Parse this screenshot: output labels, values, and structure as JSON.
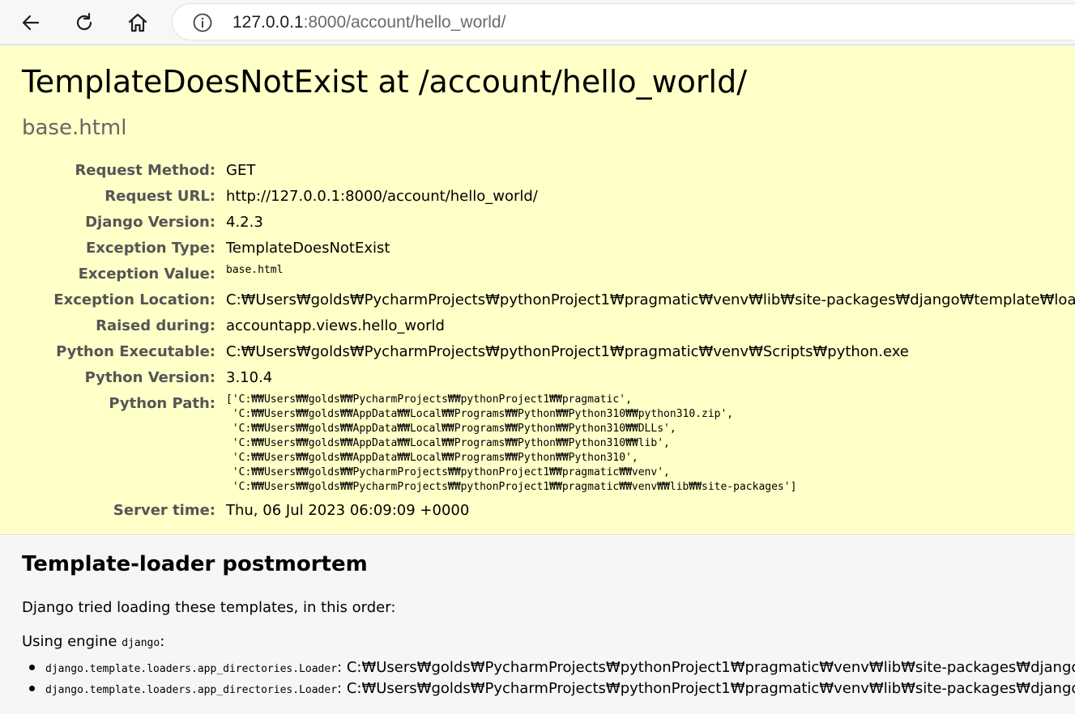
{
  "browser": {
    "url_host": "127.0.0.1",
    "url_rest": ":8000/account/hello_world/",
    "back_icon": "arrow-left-icon",
    "reload_icon": "reload-icon",
    "home_icon": "home-icon",
    "info_icon": "info-icon"
  },
  "summary": {
    "title": "TemplateDoesNotExist at /account/hello_world/",
    "subtitle": "base.html",
    "rows": [
      {
        "label": "Request Method:",
        "value": "GET"
      },
      {
        "label": "Request URL:",
        "value": "http://127.0.0.1:8000/account/hello_world/"
      },
      {
        "label": "Django Version:",
        "value": "4.2.3"
      },
      {
        "label": "Exception Type:",
        "value": "TemplateDoesNotExist"
      },
      {
        "label": "Exception Value:",
        "value": "base.html"
      },
      {
        "label": "Exception Location:",
        "value": "C:₩Users₩golds₩PycharmProjects₩pythonProject1₩pragmatic₩venv₩lib₩site-packages₩django₩template₩loader.py,"
      },
      {
        "label": "Raised during:",
        "value": "accountapp.views.hello_world"
      },
      {
        "label": "Python Executable:",
        "value": "C:₩Users₩golds₩PycharmProjects₩pythonProject1₩pragmatic₩venv₩Scripts₩python.exe"
      },
      {
        "label": "Python Version:",
        "value": "3.10.4"
      },
      {
        "label": "Python Path:",
        "value": ""
      },
      {
        "label": "Server time:",
        "value": "Thu, 06 Jul 2023 06:09:09 +0000"
      }
    ],
    "python_path": "['C:₩₩Users₩₩golds₩₩PycharmProjects₩₩pythonProject1₩₩pragmatic',\n 'C:₩₩Users₩₩golds₩₩AppData₩₩Local₩₩Programs₩₩Python₩₩Python310₩₩python310.zip',\n 'C:₩₩Users₩₩golds₩₩AppData₩₩Local₩₩Programs₩₩Python₩₩Python310₩₩DLLs',\n 'C:₩₩Users₩₩golds₩₩AppData₩₩Local₩₩Programs₩₩Python₩₩Python310₩₩lib',\n 'C:₩₩Users₩₩golds₩₩AppData₩₩Local₩₩Programs₩₩Python₩₩Python310',\n 'C:₩₩Users₩₩golds₩₩PycharmProjects₩₩pythonProject1₩₩pragmatic₩₩venv',\n 'C:₩₩Users₩₩golds₩₩PycharmProjects₩₩pythonProject1₩₩pragmatic₩₩venv₩₩lib₩₩site-packages']"
  },
  "postmortem": {
    "heading": "Template-loader postmortem",
    "intro": "Django tried loading these templates, in this order:",
    "engine_prefix": "Using engine ",
    "engine_name": "django",
    "engine_suffix": ":",
    "loaders": [
      {
        "loader": "django.template.loaders.app_directories.Loader",
        "path": ": C:₩Users₩golds₩PycharmProjects₩pythonProject1₩pragmatic₩venv₩lib₩site-packages₩django₩co"
      },
      {
        "loader": "django.template.loaders.app_directories.Loader",
        "path": ": C:₩Users₩golds₩PycharmProjects₩pythonProject1₩pragmatic₩venv₩lib₩site-packages₩django₩co"
      }
    ]
  },
  "colors": {
    "summary_bg": "#ffffc8",
    "postmortem_bg": "#f6f6f6",
    "label_color": "#555555"
  }
}
